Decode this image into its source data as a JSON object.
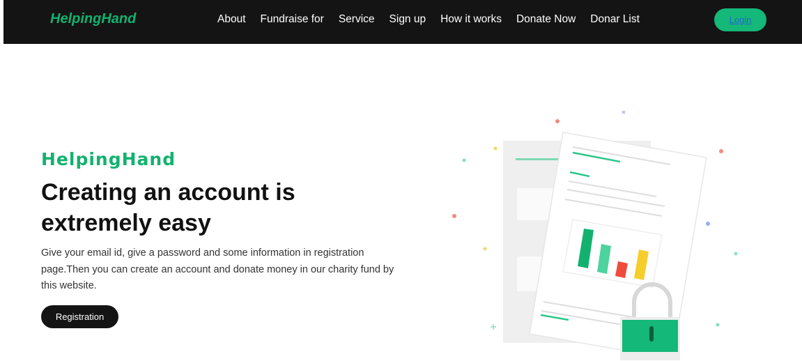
{
  "navbar": {
    "brand": "HelpingHand",
    "links": [
      "About",
      "Fundraise for",
      "Service",
      "Sign up",
      "How it works",
      "Donate Now",
      "Donar List"
    ],
    "login_label": "Login"
  },
  "hero": {
    "brand": "HelpingHand",
    "title": "Creating an account is extremely easy",
    "description": "Give your email id, give a password and some information in registration page.Then you can create an account and donate money in our charity fund by this website.",
    "button_label": "Registration"
  },
  "colors": {
    "accent": "#12b26e",
    "navbar_bg": "#141414",
    "login_bg": "#14b879",
    "button_bg": "#141414"
  },
  "illustration": {
    "icon": "document-chart-lock-illustration"
  }
}
